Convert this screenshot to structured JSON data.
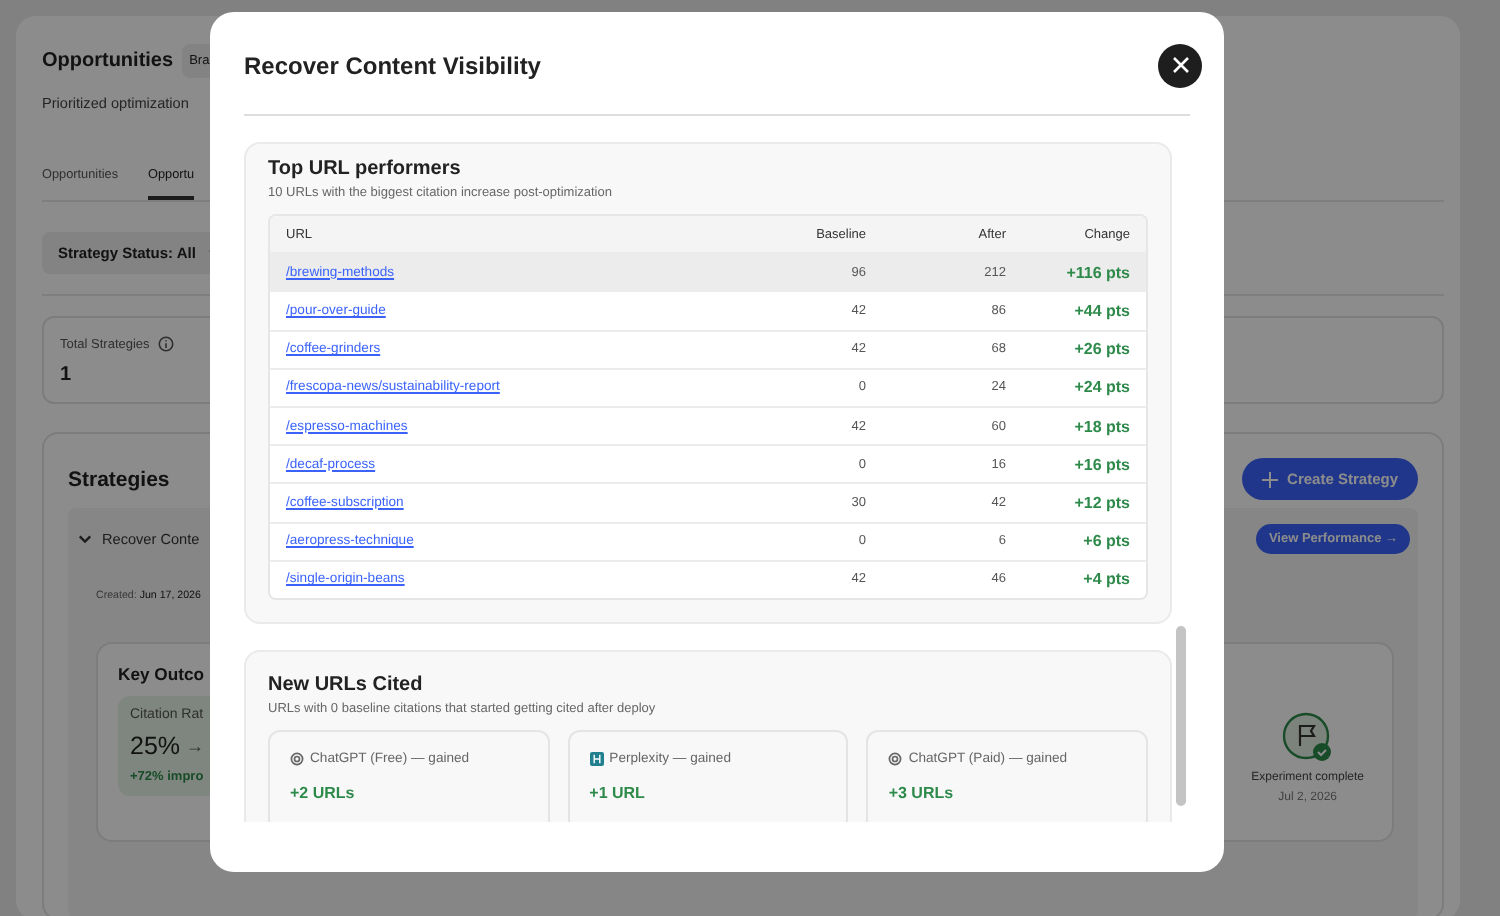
{
  "page": {
    "title": "Opportunities",
    "chip": "Bra",
    "subtitle": "Prioritized optimization",
    "tabs": [
      {
        "label": "Opportunities",
        "selected": false
      },
      {
        "label": "Opportu",
        "selected": true
      }
    ],
    "filter": "Strategy Status: All",
    "stats": {
      "label": "Total Strategies",
      "value": "1"
    },
    "strategies": {
      "title": "Strategies",
      "create_button": "Create Strategy",
      "item": {
        "title": "Recover Conte",
        "expanded": true,
        "view_button": "View Performance →",
        "created_label": "Created:",
        "created_date": "Jun 17, 2026",
        "key_outcomes": {
          "title": "Key Outco",
          "metric_label": "Citation Rat",
          "metric_value": "25%",
          "arrow": "→",
          "improvement": "+72% impro"
        },
        "milestone": {
          "label": "Experiment complete",
          "date": "Jul 2, 2026"
        }
      }
    }
  },
  "modal": {
    "title": "Recover Content Visibility",
    "top_urls": {
      "title": "Top URL performers",
      "subtitle": "10 URLs with the biggest citation increase post-optimization",
      "columns": [
        "URL",
        "Baseline",
        "After",
        "Change"
      ],
      "rows": [
        {
          "url": "/brewing-methods",
          "baseline": "96",
          "after": "212",
          "change": "+116 pts",
          "highlighted": true
        },
        {
          "url": "/pour-over-guide",
          "baseline": "42",
          "after": "86",
          "change": "+44 pts",
          "highlighted": false
        },
        {
          "url": "/coffee-grinders",
          "baseline": "42",
          "after": "68",
          "change": "+26 pts",
          "highlighted": false
        },
        {
          "url": "/frescopa-news/sustainability-report",
          "baseline": "0",
          "after": "24",
          "change": "+24 pts",
          "highlighted": false
        },
        {
          "url": "/espresso-machines",
          "baseline": "42",
          "after": "60",
          "change": "+18 pts",
          "highlighted": false
        },
        {
          "url": "/decaf-process",
          "baseline": "0",
          "after": "16",
          "change": "+16 pts",
          "highlighted": false
        },
        {
          "url": "/coffee-subscription",
          "baseline": "30",
          "after": "42",
          "change": "+12 pts",
          "highlighted": false
        },
        {
          "url": "/aeropress-technique",
          "baseline": "0",
          "after": "6",
          "change": "+6 pts",
          "highlighted": false
        },
        {
          "url": "/single-origin-beans",
          "baseline": "42",
          "after": "46",
          "change": "+4 pts",
          "highlighted": false
        }
      ]
    },
    "new_urls": {
      "title": "New URLs Cited",
      "subtitle": "URLs with 0 baseline citations that started getting cited after deploy",
      "cards": [
        {
          "kind": "knot",
          "label": "ChatGPT (Free) — gained",
          "value": "+2 URLs"
        },
        {
          "kind": "square",
          "label": "Perplexity — gained",
          "value": "+1 URL"
        },
        {
          "kind": "knot",
          "label": "ChatGPT (Paid) — gained",
          "value": "+3 URLs"
        }
      ]
    }
  }
}
